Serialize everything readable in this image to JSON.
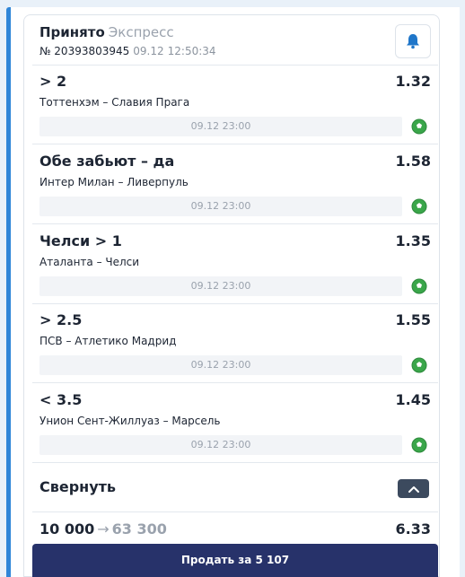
{
  "header": {
    "status": "Принято",
    "bet_type": "Экспресс",
    "number": "№ 20393803945",
    "date": "09.12",
    "time": "12:50:34",
    "icon": "bell-icon"
  },
  "events": [
    {
      "outcome": "> 2",
      "odds": "1.32",
      "match": "Тоттенхэм – Славия Прага",
      "start": "09.12 23:00",
      "sport_icon": "soccer-ball-icon"
    },
    {
      "outcome": "Обе забьют – да",
      "odds": "1.58",
      "match": "Интер Милан – Ливерпуль",
      "start": "09.12 23:00",
      "sport_icon": "soccer-ball-icon"
    },
    {
      "outcome": "Челси > 1",
      "odds": "1.35",
      "match": "Аталанта – Челси",
      "start": "09.12 23:00",
      "sport_icon": "soccer-ball-icon"
    },
    {
      "outcome": "> 2.5",
      "odds": "1.55",
      "match": "ПСВ – Атлетико Мадрид",
      "start": "09.12 23:00",
      "sport_icon": "soccer-ball-icon"
    },
    {
      "outcome": "< 3.5",
      "odds": "1.45",
      "match": "Унион Сент-Жиллуаз – Марсель",
      "start": "09.12 23:00",
      "sport_icon": "soccer-ball-icon"
    }
  ],
  "collapse": {
    "label": "Свернуть",
    "icon": "chevron-up-icon"
  },
  "totals": {
    "stake": "10 000",
    "arrow": "→",
    "potential_win": "63 300",
    "total_odds": "6.33"
  },
  "sell_button": {
    "label": "Продать за 5 107"
  },
  "colors": {
    "accent": "#2f86d8",
    "sell_button": "#27326a",
    "ball": "#3aa64a",
    "collapse_button": "#3c4a5e"
  }
}
